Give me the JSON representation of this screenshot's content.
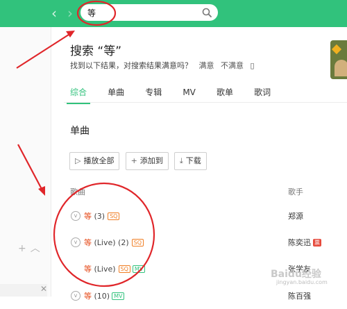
{
  "header": {
    "nav_back_icon": "chevron-left",
    "nav_forward_icon": "chevron-right",
    "search_value": "等",
    "search_icon": "search"
  },
  "page": {
    "title": "搜索 “等”",
    "feedback_question": "找到以下结果，对搜索结果满意吗？",
    "feedback_satisfied": "满意",
    "feedback_unsatisfied": "不满意",
    "feedback_extra": "▯"
  },
  "tabs": [
    {
      "label": "综合",
      "active": true
    },
    {
      "label": "单曲",
      "active": false
    },
    {
      "label": "专辑",
      "active": false
    },
    {
      "label": "MV",
      "active": false
    },
    {
      "label": "歌单",
      "active": false
    },
    {
      "label": "歌词",
      "active": false
    }
  ],
  "section": {
    "title": "单曲",
    "play_all": "播放全部",
    "add_to": "添加到",
    "download": "下载"
  },
  "columns": {
    "song": "歌曲",
    "artist": "歌手"
  },
  "songs": [
    {
      "title": "等",
      "suffix": " (3)",
      "sq": "SQ",
      "mv": "",
      "artist": "郑源",
      "vip": ""
    },
    {
      "title": "等",
      "suffix": " (Live)  (2)",
      "sq": "SQ",
      "mv": "",
      "artist": "陈奕迅",
      "vip": "票"
    },
    {
      "title": "等",
      "suffix": " (Live)",
      "sq": "SQ",
      "mv": "MV",
      "artist": "张学友",
      "vip": ""
    },
    {
      "title": "等",
      "suffix": " (10)",
      "sq": "",
      "mv": "MV",
      "artist": "陈百强",
      "vip": ""
    }
  ],
  "sidebar": {
    "add_icon": "plus",
    "collapse_icon": "chevron-up",
    "ad_close": "✕"
  },
  "watermark": {
    "text": "Baidu经验",
    "url": "jingyan.baidu.com"
  },
  "colors": {
    "accent": "#31c27c",
    "highlight": "#e64a19",
    "annotation": "#e0262a"
  }
}
